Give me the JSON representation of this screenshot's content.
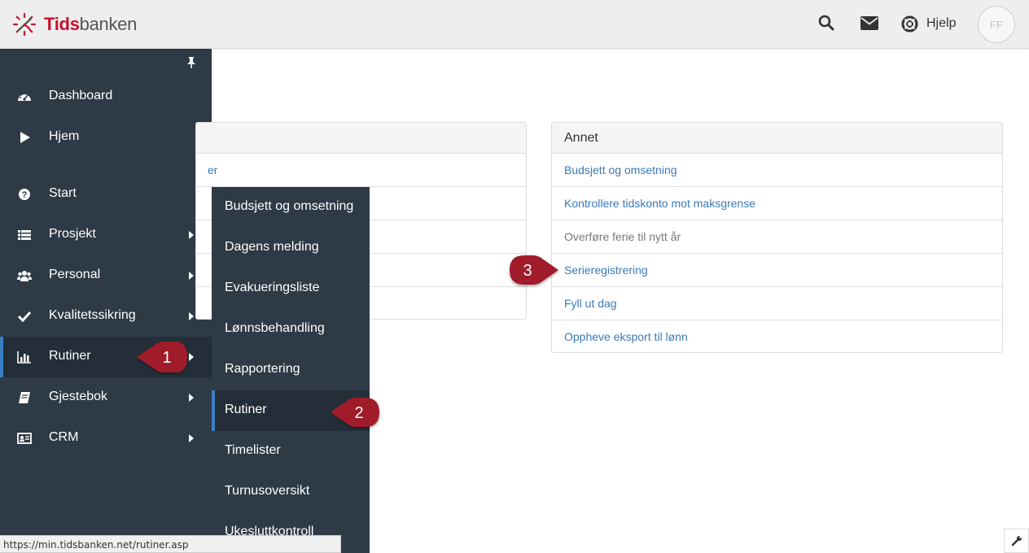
{
  "brand": {
    "name_part1": "Tids",
    "name_part2": "banken",
    "accent_color": "#c8102e"
  },
  "topbar": {
    "icons": [
      "search-icon",
      "mail-icon",
      "lifebuoy-icon"
    ],
    "help_label": "Hjelp",
    "avatar_initials": "FF"
  },
  "sidebar": {
    "pin_icon": "pin-icon",
    "items": [
      {
        "label": "Dashboard",
        "icon": "dashboard-icon"
      },
      {
        "label": "Hjem",
        "icon": "play-icon"
      },
      {
        "label": "Start",
        "icon": "question-circle-icon"
      },
      {
        "label": "Prosjekt",
        "icon": "list-icon"
      },
      {
        "label": "Personal",
        "icon": "users-icon"
      },
      {
        "label": "Kvalitetssikring",
        "icon": "check-icon"
      },
      {
        "label": "Rutiner",
        "icon": "bar-chart-icon"
      },
      {
        "label": "Gjestebok",
        "icon": "book-icon"
      },
      {
        "label": "CRM",
        "icon": "id-card-icon"
      }
    ],
    "active": "Rutiner",
    "active_color": "#3a7fc4"
  },
  "submenu": {
    "items": [
      "Budsjett og omsetning",
      "Dagens melding",
      "Evakueringsliste",
      "Lønnsbehandling",
      "Rapportering",
      "Rutiner",
      "Timelister",
      "Turnusoversikt",
      "Ukesluttkontroll"
    ],
    "active": "Rutiner"
  },
  "panel_left": {
    "row1_partial": "er"
  },
  "panel_right": {
    "title": "Annet",
    "rows": [
      "Budsjett og omsetning",
      "Kontrollere tidskonto mot maksgrense",
      "Overføre ferie til nytt år",
      "Serieregistrering",
      "Fyll ut dag",
      "Oppheve eksport til lønn"
    ]
  },
  "callouts": [
    "1",
    "2",
    "3"
  ],
  "callout_color": "#a01c2c",
  "statusbar": {
    "url": "https://min.tidsbanken.net/rutiner.asp"
  }
}
